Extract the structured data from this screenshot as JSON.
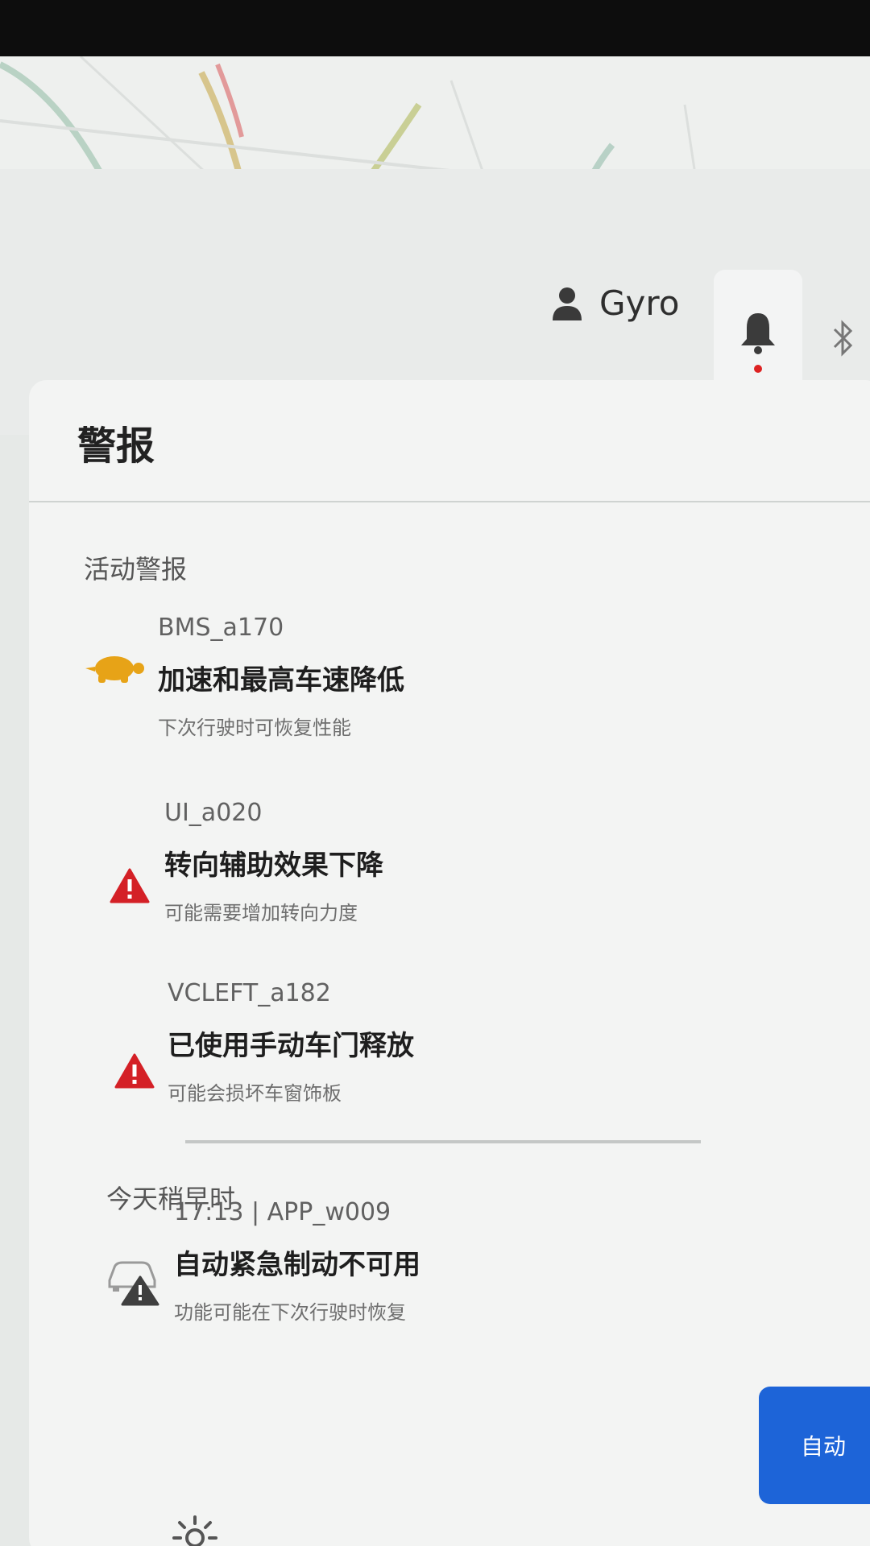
{
  "topbar": {
    "user_name": "Gyro",
    "icons": [
      "person-icon",
      "bell-icon",
      "bluetooth-icon"
    ]
  },
  "alerts_panel": {
    "title": "警报",
    "active_section_label": "活动警报",
    "active_alerts": [
      {
        "code": "BMS_a170",
        "title": "加速和最高车速降低",
        "subtitle": "下次行驶时可恢复性能",
        "icon": "turtle-icon",
        "color": "#e7a317"
      },
      {
        "code": "UI_a020",
        "title": "转向辅助效果下降",
        "subtitle": "可能需要增加转向力度",
        "icon": "warning-icon",
        "color": "#d42026"
      },
      {
        "code": "VCLEFT_a182",
        "title": "已使用手动车门释放",
        "subtitle": "可能会损坏车窗饰板",
        "icon": "warning-icon",
        "color": "#d42026"
      }
    ],
    "earlier_section_label": "今天稍早时",
    "earlier_alerts": [
      {
        "code": "17:13 | APP_w009",
        "title": "自动紧急制动不可用",
        "subtitle": "功能可能在下次行驶时恢复",
        "icon": "car-warning-icon",
        "color": "#444444"
      }
    ]
  },
  "controls": {
    "auto_button_label": "自动",
    "brightness_icon": "sun-icon"
  },
  "colors": {
    "accent": "#1d64d8",
    "notification_dot": "#dd2222"
  }
}
